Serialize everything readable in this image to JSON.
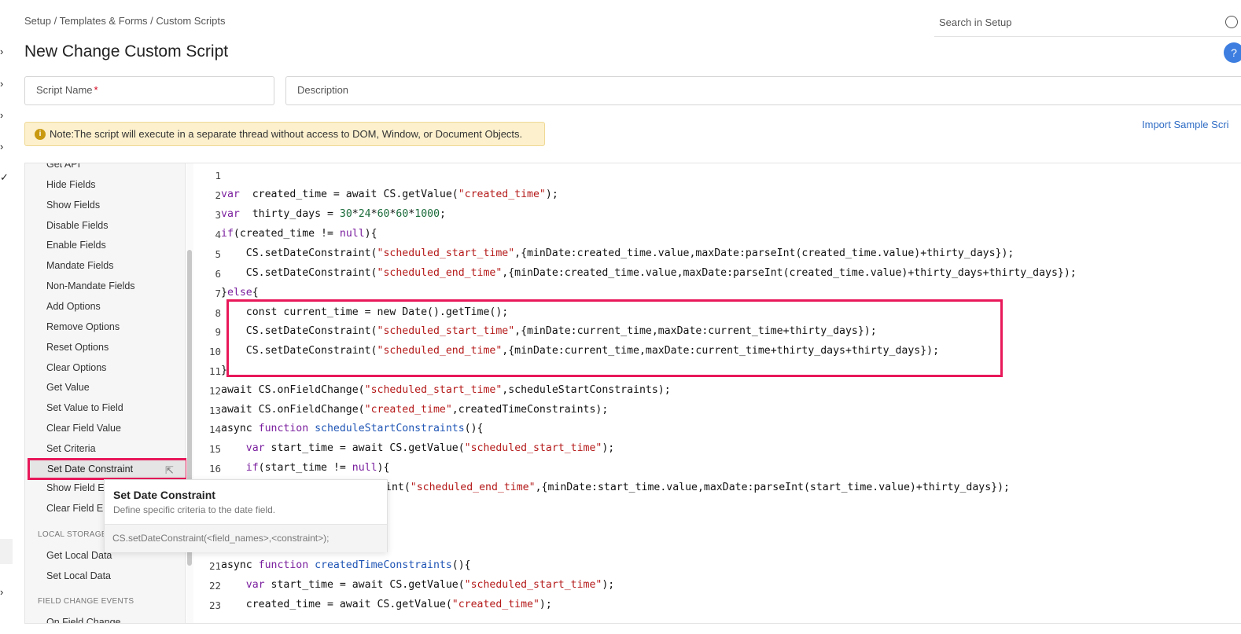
{
  "breadcrumb": "Setup / Templates & Forms / Custom Scripts",
  "page_title": "New Change Custom Script",
  "search": {
    "placeholder": "Search in Setup"
  },
  "form": {
    "script_name_label": "Script Name",
    "required_mark": "*",
    "description_label": "Description"
  },
  "note": {
    "icon": "info-icon",
    "text": "Note:The script will execute in a separate thread without access to DOM, Window, or Document Objects."
  },
  "import_link": "Import Sample Scri",
  "left_rail_glyphs": [
    "›",
    "›",
    "›",
    "›",
    "›",
    "✓",
    "›"
  ],
  "sidebar": {
    "items": [
      "Get API",
      "Hide Fields",
      "Show Fields",
      "Disable Fields",
      "Enable Fields",
      "Mandate Fields",
      "Non-Mandate Fields",
      "Add Options",
      "Remove Options",
      "Reset Options",
      "Clear Options",
      "Get Value",
      "Set Value to Field",
      "Clear Field Value",
      "Set Criteria"
    ],
    "selected": "Set Date Constraint",
    "items_after": [
      "Show Field Er",
      "Clear Field Er"
    ],
    "local_storage_heading": "LOCAL STORAGE",
    "local_storage_items": [
      "Get Local Data",
      "Set Local Data"
    ],
    "field_change_heading": "FIELD CHANGE EVENTS",
    "field_change_items": [
      "On Field Change"
    ]
  },
  "tooltip": {
    "title": "Set Date Constraint",
    "description": "Define specific criteria to the date field.",
    "syntax": "CS.setDateConstraint(<field_names>,<constraint>);"
  },
  "code": {
    "line_numbers": [
      "1",
      "2",
      "3",
      "4",
      "5",
      "6",
      "7",
      "8",
      "9",
      "10",
      "11",
      "12",
      "13",
      "14",
      "15",
      "16",
      "21",
      "22",
      "23"
    ],
    "lines": [
      [],
      [
        [
          "kw",
          "var"
        ],
        [
          "",
          "  created_time = await CS.getValue("
        ],
        [
          "str",
          "\"created_time\""
        ],
        [
          "",
          ");"
        ]
      ],
      [
        [
          "kw",
          "var"
        ],
        [
          "",
          "  thirty_days = "
        ],
        [
          "num",
          "30"
        ],
        [
          "",
          "*"
        ],
        [
          "num",
          "24"
        ],
        [
          "",
          "*"
        ],
        [
          "num",
          "60"
        ],
        [
          "",
          "*"
        ],
        [
          "num",
          "60"
        ],
        [
          "",
          "*"
        ],
        [
          "num",
          "1000"
        ],
        [
          "",
          ";"
        ]
      ],
      [
        [
          "kw",
          "if"
        ],
        [
          "",
          "(created_time != "
        ],
        [
          "kw",
          "null"
        ],
        [
          "",
          "){"
        ]
      ],
      [
        [
          "",
          "    CS.setDateConstraint("
        ],
        [
          "str",
          "\"scheduled_start_time\""
        ],
        [
          "",
          ",{minDate:created_time.value,maxDate:parseInt(created_time.value)+thirty_days});"
        ]
      ],
      [
        [
          "",
          "    CS.setDateConstraint("
        ],
        [
          "str",
          "\"scheduled_end_time\""
        ],
        [
          "",
          ",{minDate:created_time.value,maxDate:parseInt(created_time.value)+thirty_days+thirty_days});"
        ]
      ],
      [
        [
          "",
          "}"
        ],
        [
          "kw",
          "else"
        ],
        [
          "",
          "{"
        ]
      ],
      [
        [
          "",
          "    const current_time = new Date().getTime();"
        ]
      ],
      [
        [
          "",
          "    CS.setDateConstraint("
        ],
        [
          "str",
          "\"scheduled_start_time\""
        ],
        [
          "",
          ",{minDate:current_time,maxDate:current_time+thirty_days});"
        ]
      ],
      [
        [
          "",
          "    CS.setDateConstraint("
        ],
        [
          "str",
          "\"scheduled_end_time\""
        ],
        [
          "",
          ",{minDate:current_time,maxDate:current_time+thirty_days+thirty_days});"
        ]
      ],
      [
        [
          "",
          "}"
        ]
      ],
      [
        [
          "",
          "await CS.onFieldChange("
        ],
        [
          "str",
          "\"scheduled_start_time\""
        ],
        [
          "",
          ",scheduleStartConstraints);"
        ]
      ],
      [
        [
          "",
          "await CS.onFieldChange("
        ],
        [
          "str",
          "\"created_time\""
        ],
        [
          "",
          ",createdTimeConstraints);"
        ]
      ],
      [
        [
          "",
          "async "
        ],
        [
          "kw",
          "function"
        ],
        [
          "fn",
          " scheduleStartConstraints"
        ],
        [
          "",
          "(){"
        ]
      ],
      [
        [
          "",
          "    "
        ],
        [
          "kw",
          "var"
        ],
        [
          "",
          " start_time = await CS.getValue("
        ],
        [
          "str",
          "\"scheduled_start_time\""
        ],
        [
          "",
          ");"
        ]
      ],
      [
        [
          "",
          "    "
        ],
        [
          "kw",
          "if"
        ],
        [
          "",
          "(start_time != "
        ],
        [
          "kw",
          "null"
        ],
        [
          "",
          "){"
        ]
      ],
      [
        [
          "",
          "async "
        ],
        [
          "kw",
          "function"
        ],
        [
          "fn",
          " createdTimeConstraints"
        ],
        [
          "",
          "(){"
        ]
      ],
      [
        [
          "",
          "    "
        ],
        [
          "kw",
          "var"
        ],
        [
          "",
          " start_time = await CS.getValue("
        ],
        [
          "str",
          "\"scheduled_start_time\""
        ],
        [
          "",
          ");"
        ]
      ],
      [
        [
          "",
          "    created_time = await CS.getValue("
        ],
        [
          "str",
          "\"created_time\""
        ],
        [
          "",
          ");"
        ]
      ]
    ],
    "partial_line": [
      [
        "",
        "int("
      ],
      [
        "str",
        "\"scheduled_end_time\""
      ],
      [
        "",
        ",{minDate:start_time.value,maxDate:parseInt(start_time.value)+thirty_days});"
      ]
    ]
  }
}
